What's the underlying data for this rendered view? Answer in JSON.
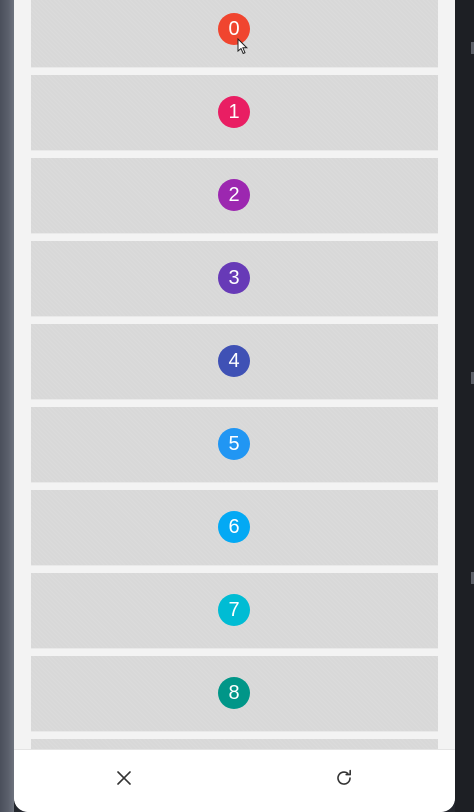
{
  "list": {
    "items": [
      {
        "label": "0",
        "color": "#f0452f"
      },
      {
        "label": "1",
        "color": "#e91e63"
      },
      {
        "label": "2",
        "color": "#9c27b0"
      },
      {
        "label": "3",
        "color": "#673ab7"
      },
      {
        "label": "4",
        "color": "#3f51b5"
      },
      {
        "label": "5",
        "color": "#2196f3"
      },
      {
        "label": "6",
        "color": "#03a9f4"
      },
      {
        "label": "7",
        "color": "#00bcd4"
      },
      {
        "label": "8",
        "color": "#009688"
      },
      {
        "label": "",
        "color": "#4caf50"
      }
    ]
  },
  "bottom_bar": {
    "close_icon": "close-icon",
    "refresh_icon": "refresh-icon"
  },
  "colors": {
    "item_background": "#d8d8d8",
    "sheet_background": "#f3f3f3",
    "icon_color": "#333333"
  }
}
